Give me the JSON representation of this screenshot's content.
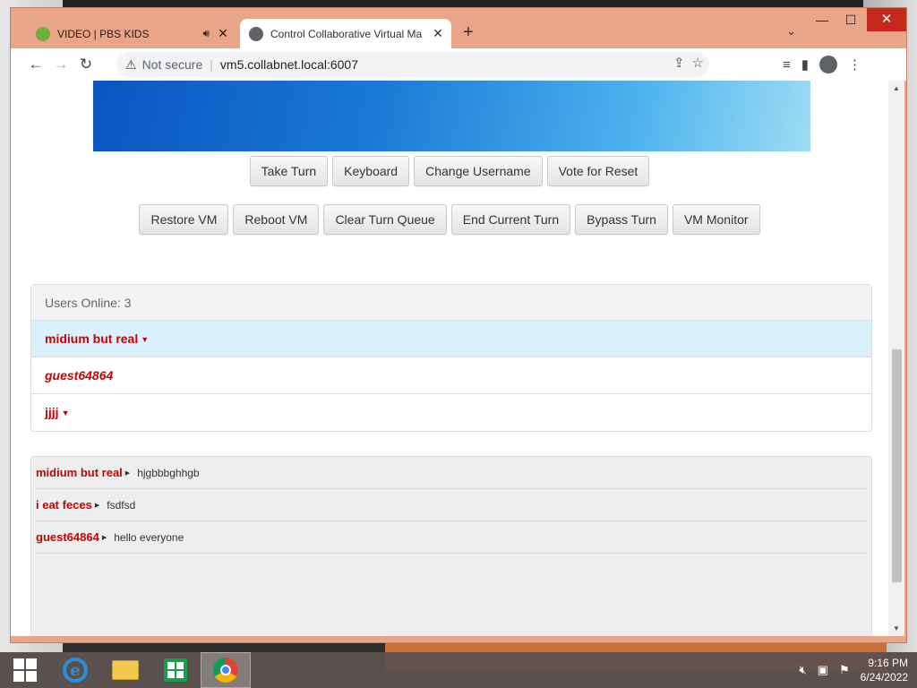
{
  "browser": {
    "tabs": [
      {
        "title": "VIDEO | PBS KIDS",
        "active": false,
        "audio": true
      },
      {
        "title": "Control Collaborative Virtual Ma",
        "active": true,
        "audio": false
      }
    ],
    "new_tab_label": "+",
    "address": {
      "security": "Not secure",
      "url": "vm5.collabnet.local:6007"
    }
  },
  "vm_buttons_row1": [
    "Take Turn",
    "Keyboard",
    "Change Username",
    "Vote for Reset"
  ],
  "vm_buttons_row2": [
    "Restore VM",
    "Reboot VM",
    "Clear Turn Queue",
    "End Current Turn",
    "Bypass Turn",
    "VM Monitor"
  ],
  "users": {
    "header": "Users Online: 3",
    "list": [
      {
        "name": "midium but real",
        "selected": true,
        "italic": false,
        "has_menu": true
      },
      {
        "name": "guest64864",
        "selected": false,
        "italic": true,
        "has_menu": false
      },
      {
        "name": "jjjj",
        "selected": false,
        "italic": false,
        "has_menu": true
      }
    ]
  },
  "chat": [
    {
      "user": "midium but real",
      "message": "hjgbbbghhgb"
    },
    {
      "user": "i eat feces",
      "message": "fsdfsd"
    },
    {
      "user": "guest64864",
      "message": "hello everyone"
    }
  ],
  "taskbar": {
    "apps": [
      "start-button",
      "internet-explorer",
      "file-explorer",
      "store",
      "chrome"
    ],
    "time": "9:16 PM",
    "date": "6/24/2022"
  },
  "colors": {
    "user_name": "#cc0000",
    "selected_row": "#d9f1fb",
    "window_frame": "#e9a58a"
  }
}
